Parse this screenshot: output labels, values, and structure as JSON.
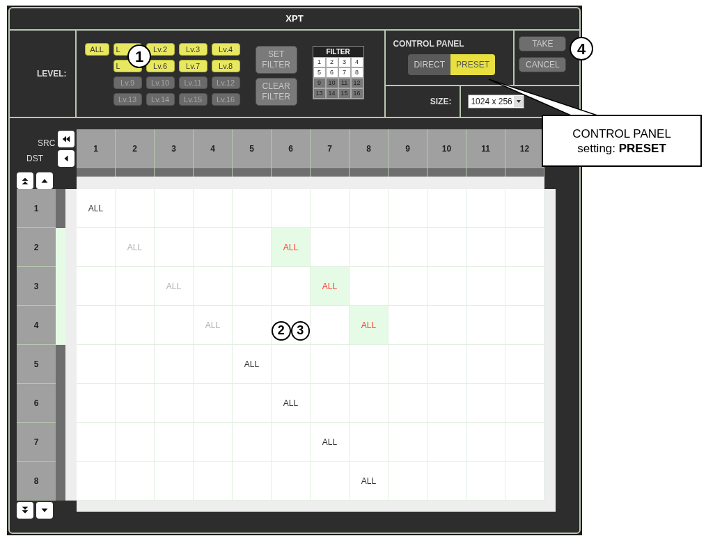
{
  "window": {
    "title": "XPT"
  },
  "level": {
    "label": "LEVEL:",
    "buttons": [
      {
        "label": "ALL",
        "on": true,
        "obscured": false
      },
      {
        "label": "L",
        "on": true,
        "obscured": true
      },
      {
        "label": "Lv.2",
        "on": true,
        "obscured": false
      },
      {
        "label": "Lv.3",
        "on": true,
        "obscured": false
      },
      {
        "label": "Lv.4",
        "on": true,
        "obscured": false
      },
      {
        "label": "L",
        "on": true,
        "obscured": true
      },
      {
        "label": "Lv.6",
        "on": true,
        "obscured": false
      },
      {
        "label": "Lv.7",
        "on": true,
        "obscured": false
      },
      {
        "label": "Lv.8",
        "on": true,
        "obscured": false
      },
      {
        "label": "Lv.9",
        "on": false,
        "obscured": false
      },
      {
        "label": "Lv.10",
        "on": false,
        "obscured": false
      },
      {
        "label": "Lv.11",
        "on": false,
        "obscured": false
      },
      {
        "label": "Lv.12",
        "on": false,
        "obscured": false
      },
      {
        "label": "Lv.13",
        "on": false,
        "obscured": false
      },
      {
        "label": "Lv.14",
        "on": false,
        "obscured": false
      },
      {
        "label": "Lv.15",
        "on": false,
        "obscured": false
      },
      {
        "label": "Lv.16",
        "on": false,
        "obscured": false
      }
    ],
    "set_filter": "SET FILTER",
    "clear_filter": "CLEAR FILTER"
  },
  "filter": {
    "title": "FILTER",
    "cells": [
      {
        "label": "1",
        "on": true
      },
      {
        "label": "2",
        "on": true
      },
      {
        "label": "3",
        "on": true
      },
      {
        "label": "4",
        "on": true
      },
      {
        "label": "5",
        "on": true
      },
      {
        "label": "6",
        "on": true
      },
      {
        "label": "7",
        "on": true
      },
      {
        "label": "8",
        "on": true
      },
      {
        "label": "9",
        "on": false
      },
      {
        "label": "10",
        "on": false
      },
      {
        "label": "11",
        "on": false
      },
      {
        "label": "12",
        "on": false
      },
      {
        "label": "13",
        "on": false
      },
      {
        "label": "14",
        "on": false
      },
      {
        "label": "15",
        "on": false
      },
      {
        "label": "16",
        "on": false
      }
    ]
  },
  "control_panel": {
    "title": "CONTROL PANEL",
    "modes": [
      {
        "label": "DIRECT",
        "selected": false
      },
      {
        "label": "PRESET",
        "selected": true
      }
    ]
  },
  "actions": [
    "TAKE",
    "CANCEL"
  ],
  "size": {
    "label": "SIZE:",
    "value": "1024 x 256"
  },
  "grid": {
    "src_label": "SRC",
    "dst_label": "DST",
    "columns": [
      "1",
      "2",
      "3",
      "4",
      "5",
      "6",
      "7",
      "8",
      "9",
      "10",
      "11",
      "12"
    ],
    "rows": [
      {
        "label": "1",
        "pending": false,
        "cells": [
          {
            "text": "ALL",
            "dimmed": false,
            "pending": false
          },
          {},
          {},
          {},
          {},
          {},
          {},
          {},
          {},
          {},
          {},
          {}
        ]
      },
      {
        "label": "2",
        "pending": true,
        "cells": [
          {},
          {
            "text": "ALL",
            "dimmed": true,
            "pending": false
          },
          {},
          {},
          {},
          {
            "text": "ALL",
            "dimmed": false,
            "pending": true
          },
          {},
          {},
          {},
          {},
          {},
          {}
        ]
      },
      {
        "label": "3",
        "pending": true,
        "cells": [
          {},
          {},
          {
            "text": "ALL",
            "dimmed": true,
            "pending": false
          },
          {},
          {},
          {},
          {
            "text": "ALL",
            "dimmed": false,
            "pending": true
          },
          {},
          {},
          {},
          {},
          {}
        ]
      },
      {
        "label": "4",
        "pending": true,
        "cells": [
          {},
          {},
          {},
          {
            "text": "ALL",
            "dimmed": true,
            "pending": false
          },
          {},
          {
            "badges": [
              "2",
              "3"
            ]
          },
          {},
          {
            "text": "ALL",
            "dimmed": false,
            "pending": true
          },
          {},
          {},
          {},
          {}
        ]
      },
      {
        "label": "5",
        "pending": false,
        "cells": [
          {},
          {},
          {},
          {},
          {
            "text": "ALL",
            "dimmed": false,
            "pending": false
          },
          {},
          {},
          {},
          {},
          {},
          {},
          {}
        ]
      },
      {
        "label": "6",
        "pending": false,
        "cells": [
          {},
          {},
          {},
          {},
          {},
          {
            "text": "ALL",
            "dimmed": false,
            "pending": false
          },
          {},
          {},
          {},
          {},
          {},
          {}
        ]
      },
      {
        "label": "7",
        "pending": false,
        "cells": [
          {},
          {},
          {},
          {},
          {},
          {},
          {
            "text": "ALL",
            "dimmed": false,
            "pending": false
          },
          {},
          {},
          {},
          {},
          {}
        ]
      },
      {
        "label": "8",
        "pending": false,
        "cells": [
          {},
          {},
          {},
          {},
          {},
          {},
          {},
          {
            "text": "ALL",
            "dimmed": false,
            "pending": false
          },
          {},
          {},
          {},
          {}
        ]
      }
    ]
  },
  "annotations": [
    {
      "label": "1"
    },
    {
      "label": "4"
    }
  ],
  "callout": {
    "text": "CONTROL PANEL setting: **PRESET**"
  }
}
